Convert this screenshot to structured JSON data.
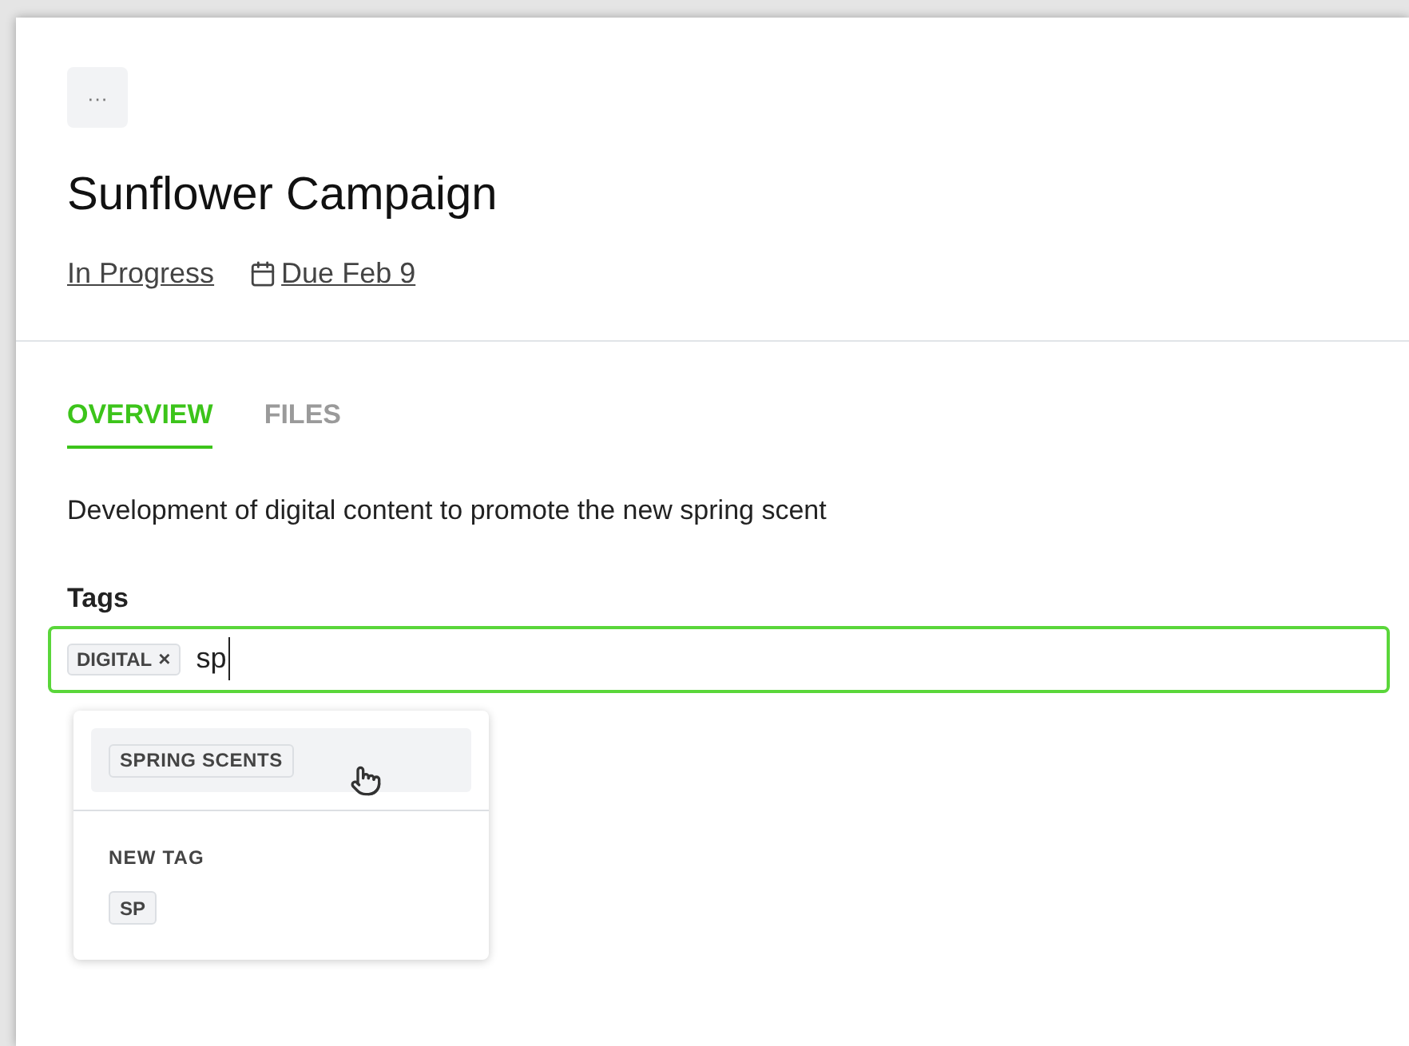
{
  "menu_button": "···",
  "title": "Sunflower Campaign",
  "meta": {
    "status": "In Progress",
    "due": "Due Feb 9"
  },
  "tabs": [
    {
      "label": "OVERVIEW",
      "selected": true
    },
    {
      "label": "FILES",
      "selected": false
    }
  ],
  "description": "Development of digital content to promote the new spring scent",
  "tags": {
    "label": "Tags",
    "chips": [
      {
        "label": "DIGITAL",
        "remove": "×"
      }
    ],
    "value": "sp",
    "dropdown": {
      "suggestions": [
        {
          "label": "SPRING SCENTS",
          "hovered": true
        }
      ],
      "new_tag": {
        "heading": "NEW TAG",
        "chip": "SP"
      }
    }
  }
}
